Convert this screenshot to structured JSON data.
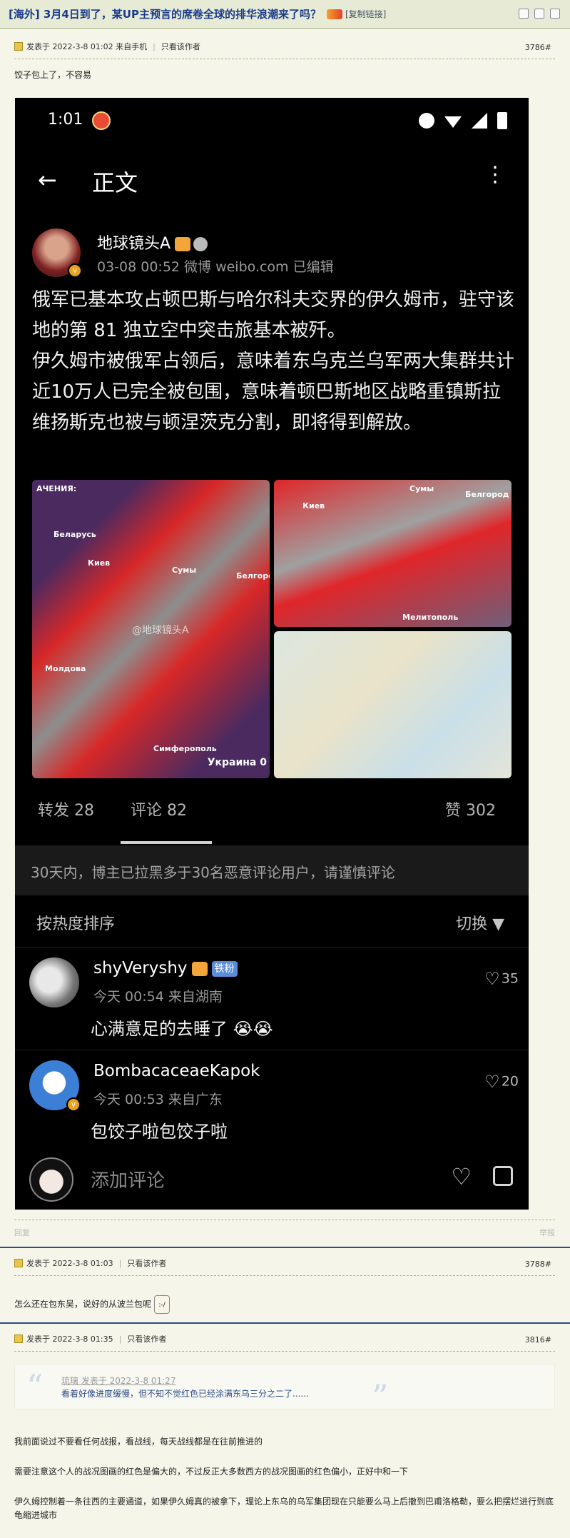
{
  "header": {
    "title": "[海外] 3月4日到了，某UP主预言的席卷全球的排华浪潮来了吗？",
    "copy_link": "[复制链接]"
  },
  "posts": [
    {
      "meta_posted": "发表于 2022-3-8 01:02 来自手机",
      "only_author": "只看该作者",
      "floor": "3786#",
      "text": "饺子包上了，不容易",
      "reply": "回复",
      "report": "举报"
    },
    {
      "meta_posted": "发表于 2022-3-8 01:03",
      "only_author": "只看该作者",
      "floor": "3788#",
      "text": "怎么还在包东吴，说好的从波兰包呢"
    },
    {
      "meta_posted": "发表于 2022-3-8 01:35",
      "only_author": "只看该作者",
      "floor": "3816#",
      "quote_head": "琉璃 发表于 2022-3-8 01:27",
      "quote_body": "看着好像进度缓慢，但不知不觉红色已经涂满东乌三分之二了......",
      "paragraphs": [
        "我前面说过不要看任何战报，看战线，每天战线都是在往前推进的",
        "需要注意这个人的战况图画的红色是偏大的，不过反正大多数西方的战况图画的红色偏小，正好中和一下",
        "伊久姆控制着一条往西的主要通道，如果伊久姆真的被拿下，理论上东乌的乌军集团现在只能要么马上后撤到巴甫洛格勒，要么把摆烂进行到底龟缩进城市"
      ]
    }
  ],
  "screenshot": {
    "status_time": "1:01",
    "nav_title": "正文",
    "author_name": "地球镜头A",
    "author_meta": "03-08 00:52  微博 weibo.com  已编辑",
    "body": "俄军已基本攻占顿巴斯与哈尔科夫交界的伊久姆市，驻守该地的第 81 独立空中突击旅基本被歼。\n伊久姆市被俄军占领后，意味着东乌克兰乌军两大集群共计近10万人已完全被包围，意味着顿巴斯地区战略重镇斯拉维扬斯克也被与顿涅茨克分割，即将得到解放。",
    "map_labels": {
      "m1_top": "АЧЕНИЯ:",
      "m1_belarus": "Беларусь",
      "m1_kiev": "Киев",
      "m1_sumy": "Сумы",
      "m1_belgorod": "Белгород",
      "m1_moldova": "Молдова",
      "m1_simferopol": "Симферополь",
      "m1_footer": "Украина 0",
      "watermark": "@地球镜头A",
      "m2_sumy": "Сумы",
      "m2_belgorod": "Белгород",
      "m2_kiev": "Киев",
      "m2_melitopol": "Мелитополь"
    },
    "repost": "转发 28",
    "comments": "评论 82",
    "likes": "赞 302",
    "notice": "30天内，博主已拉黑多于30名恶意评论用户，请谨慎评论",
    "sort_label": "按热度排序",
    "switch_label": "切换",
    "comment_list": [
      {
        "name": "shyVeryshy",
        "badge": "铁粉",
        "meta": "今天 00:54 来自湖南",
        "text": "心满意足的去睡了",
        "likes": "35"
      },
      {
        "name": "BombacaceaeKapok",
        "meta": "今天 00:53 来自广东",
        "text": "包饺子啦包饺子啦",
        "likes": "20"
      }
    ],
    "add_comment": "添加评论"
  }
}
